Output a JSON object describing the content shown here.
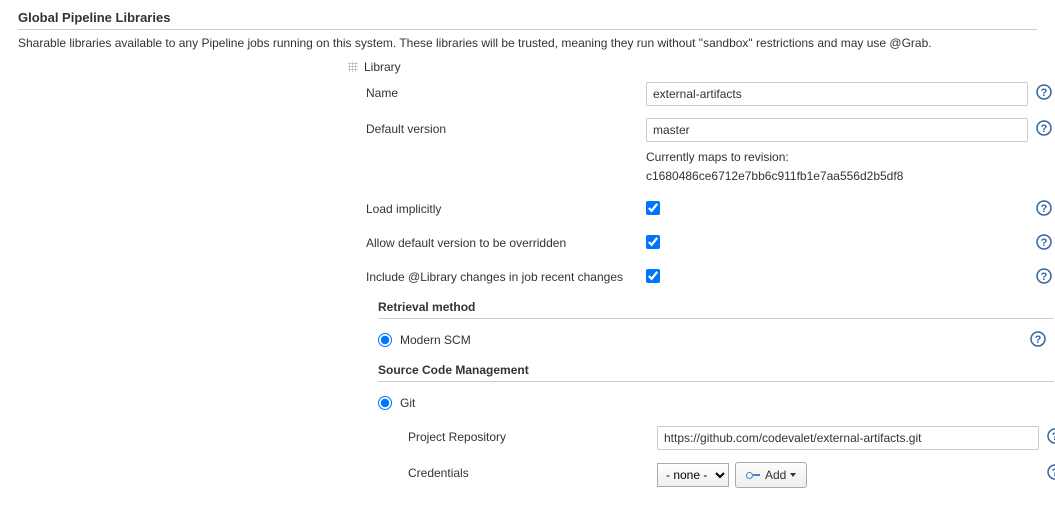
{
  "section": {
    "title": "Global Pipeline Libraries",
    "description": "Sharable libraries available to any Pipeline jobs running on this system. These libraries will be trusted, meaning they run without \"sandbox\" restrictions and may use @Grab."
  },
  "library": {
    "header": "Library",
    "name_label": "Name",
    "name_value": "external-artifacts",
    "default_version_label": "Default version",
    "default_version_value": "master",
    "revision_hint_line1": "Currently maps to revision:",
    "revision_hint_line2": "c1680486ce6712e7bb6c911fb1e7aa556d2b5df8",
    "load_implicitly_label": "Load implicitly",
    "allow_override_label": "Allow default version to be overridden",
    "include_changes_label": "Include @Library changes in job recent changes"
  },
  "retrieval": {
    "title": "Retrieval method",
    "modern_scm_label": "Modern SCM"
  },
  "scm": {
    "title": "Source Code Management",
    "git_label": "Git",
    "repo_label": "Project Repository",
    "repo_value": "https://github.com/codevalet/external-artifacts.git",
    "credentials_label": "Credentials",
    "credentials_selected": "- none -",
    "add_button_label": "Add"
  }
}
